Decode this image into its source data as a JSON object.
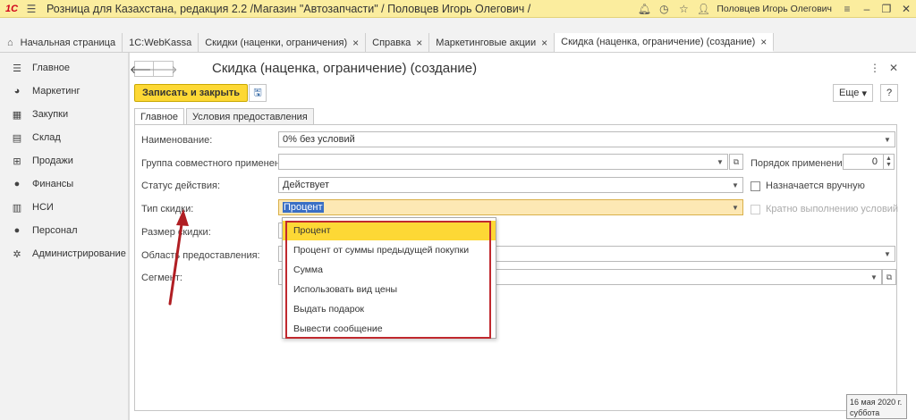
{
  "window": {
    "logo": "1С",
    "title": "Розница для Казахстана, редакция 2.2 /Магазин \"Автозапчасти\" / Половцев Игорь Олегович /",
    "user_name": "Половцев Игорь Олегович"
  },
  "tabs": [
    {
      "label": "Начальная страница"
    },
    {
      "label": "1С:WebKassa"
    },
    {
      "label": "Скидки (наценки, ограничения)"
    },
    {
      "label": "Справка"
    },
    {
      "label": "Маркетинговые акции"
    },
    {
      "label": "Скидка (наценка, ограничение) (создание)"
    }
  ],
  "sidebar": {
    "items": [
      {
        "label": "Главное",
        "icon": "menu-icon"
      },
      {
        "label": "Маркетинг",
        "icon": "pie-icon"
      },
      {
        "label": "Закупки",
        "icon": "purchases-icon"
      },
      {
        "label": "Склад",
        "icon": "warehouse-icon"
      },
      {
        "label": "Продажи",
        "icon": "sales-icon"
      },
      {
        "label": "Финансы",
        "icon": "finance-icon"
      },
      {
        "label": "НСИ",
        "icon": "reference-icon"
      },
      {
        "label": "Персонал",
        "icon": "person-icon"
      },
      {
        "label": "Администрирование",
        "icon": "gear-icon"
      }
    ]
  },
  "form": {
    "title": "Скидка (наценка, ограничение) (создание)",
    "save_close_label": "Записать и закрыть",
    "more_label": "Еще",
    "help_label": "?",
    "tabs": [
      "Главное",
      "Условия предоставления"
    ],
    "fields": {
      "name_label": "Наименование:",
      "name_value": "0% без условий",
      "group_label": "Группа совместного применения:",
      "group_value": "",
      "order_label": "Порядок применения:",
      "order_value": "0",
      "status_label": "Статус действия:",
      "status_value": "Действует",
      "manual_label": "Назначается вручную",
      "type_label": "Тип скидки:",
      "type_value": "Процент",
      "multiple_label": "Кратно выполнению условий",
      "size_label": "Размер скидки:",
      "scope_label": "Область предоставления:",
      "segment_label": "Сегмент:"
    },
    "dropdown_options": [
      "Процент",
      "Процент от суммы предыдущей покупки",
      "Сумма",
      "Использовать вид цены",
      "Выдать подарок",
      "Вывести сообщение"
    ]
  },
  "status": {
    "date": "16 мая 2020 г.",
    "weekday": "суббота"
  },
  "colors": {
    "title_bar": "#fbed9e",
    "primary_button": "#fdd835",
    "selection": "#3a6fc5",
    "annotation_red": "#c0282d"
  }
}
